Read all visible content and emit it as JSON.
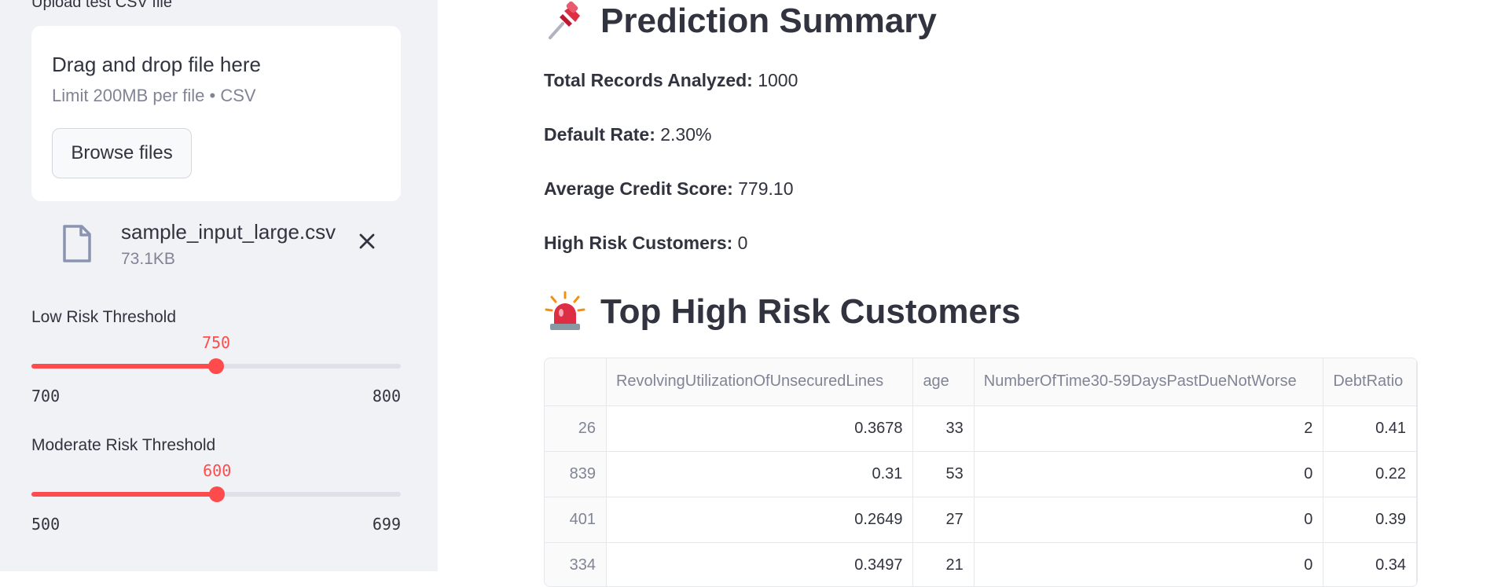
{
  "sidebar": {
    "upload_label": "Upload test CSV file",
    "dropzone": {
      "title": "Drag and drop file here",
      "limit": "Limit 200MB per file • CSV",
      "browse_label": "Browse files"
    },
    "file": {
      "name": "sample_input_large.csv",
      "size": "73.1KB",
      "icon": "file-icon"
    },
    "sliders": [
      {
        "label": "Low Risk Threshold",
        "value": "750",
        "min": "700",
        "max": "800",
        "fraction": 0.5
      },
      {
        "label": "Moderate Risk Threshold",
        "value": "600",
        "min": "500",
        "max": "699",
        "fraction": 0.5025
      }
    ]
  },
  "main": {
    "summary": {
      "emoji": "pushpin-icon",
      "title": "Prediction Summary",
      "stats": [
        {
          "label": "Total Records Analyzed:",
          "value": "1000"
        },
        {
          "label": "Default Rate:",
          "value": "2.30%"
        },
        {
          "label": "Average Credit Score:",
          "value": "779.10"
        },
        {
          "label": "High Risk Customers:",
          "value": "0"
        }
      ]
    },
    "high_risk": {
      "emoji": "rotating-light-icon",
      "title": "Top High Risk Customers",
      "columns": [
        "",
        "RevolvingUtilizationOfUnsecuredLines",
        "age",
        "NumberOfTime30-59DaysPastDueNotWorse",
        "DebtRatio"
      ],
      "rows": [
        {
          "index": "26",
          "cells": [
            "0.3678",
            "33",
            "2",
            "0.41"
          ]
        },
        {
          "index": "839",
          "cells": [
            "0.31",
            "53",
            "0",
            "0.22"
          ]
        },
        {
          "index": "401",
          "cells": [
            "0.2649",
            "27",
            "0",
            "0.39"
          ]
        },
        {
          "index": "334",
          "cells": [
            "0.3497",
            "21",
            "0",
            "0.34"
          ]
        }
      ]
    }
  },
  "colors": {
    "accent": "#ff4b4b",
    "sidebar_bg": "#f0f2f6",
    "text": "#31333f",
    "muted": "#808495"
  }
}
